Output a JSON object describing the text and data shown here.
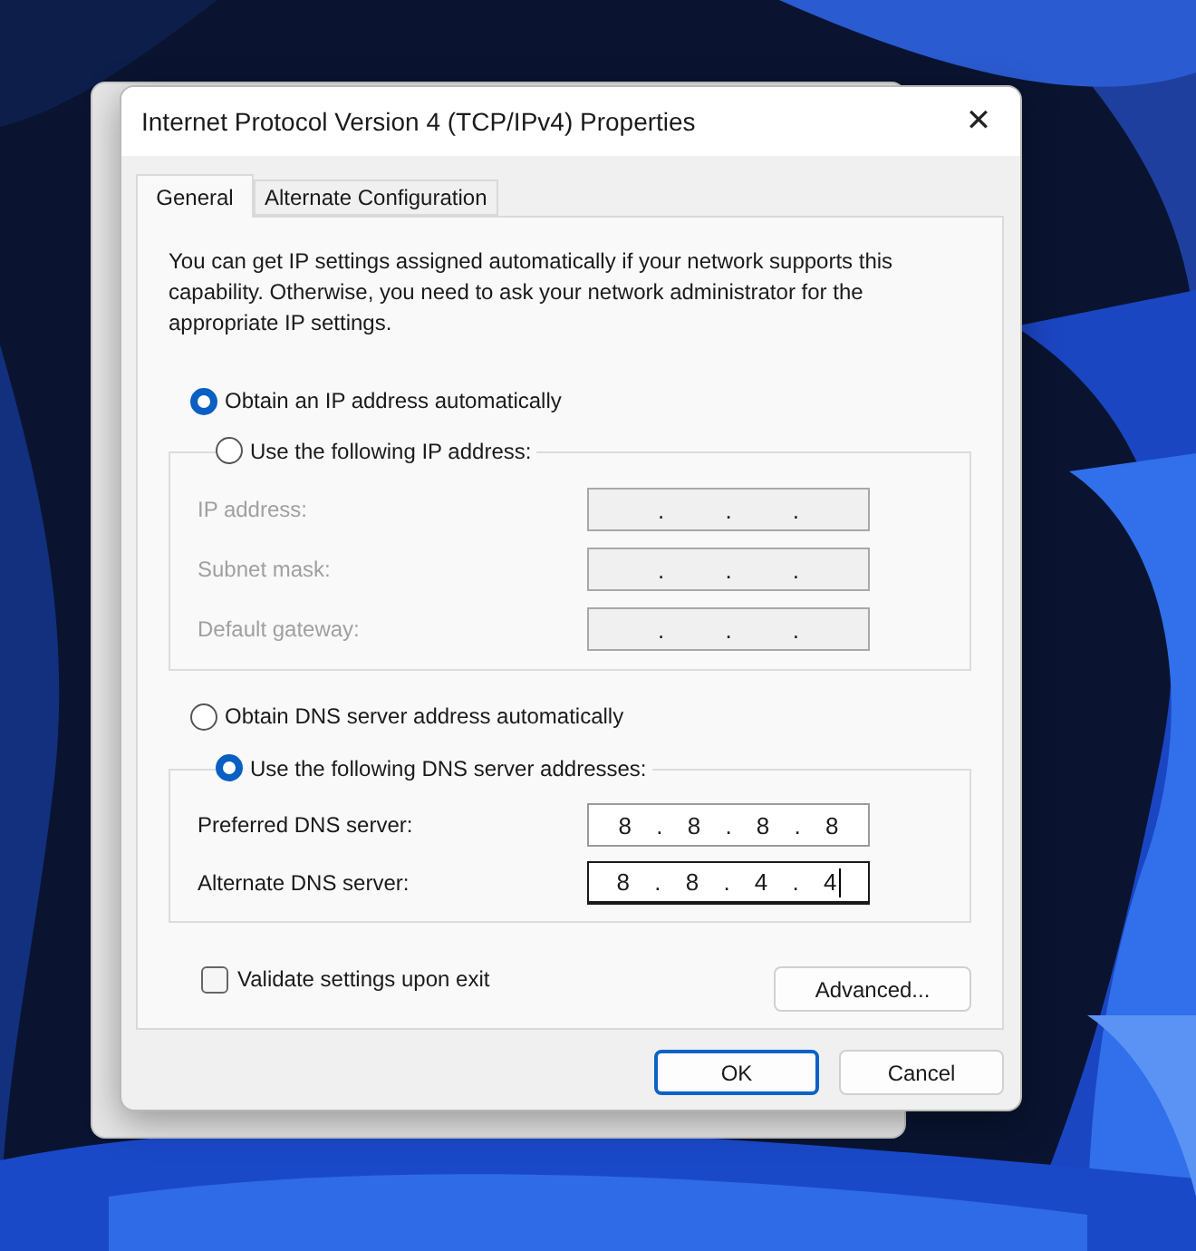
{
  "window": {
    "title": "Internet Protocol Version 4 (TCP/IPv4) Properties",
    "close": "✕"
  },
  "tabs": [
    {
      "label": "General",
      "selected": true
    },
    {
      "label": "Alternate Configuration",
      "selected": false
    }
  ],
  "description": "You can get IP settings assigned automatically if your network supports this capability. Otherwise, you need to ask your network administrator for the appropriate IP settings.",
  "ip_mode": [
    {
      "label": "Obtain an IP address automatically",
      "selected": true
    },
    {
      "label": "Use the following IP address:",
      "selected": false
    }
  ],
  "ip_fields": [
    {
      "label": "IP address:",
      "value": ". . .",
      "disabled": true
    },
    {
      "label": "Subnet mask:",
      "value": ". . .",
      "disabled": true
    },
    {
      "label": "Default gateway:",
      "value": ". . .",
      "disabled": true
    }
  ],
  "dns_mode": [
    {
      "label": "Obtain DNS server address automatically",
      "selected": false
    },
    {
      "label": "Use the following DNS server addresses:",
      "selected": true
    }
  ],
  "dns_fields": [
    {
      "label": "Preferred DNS server:",
      "value": "8 . 8 . 8 . 8",
      "disabled": false,
      "focused": false
    },
    {
      "label": "Alternate DNS server:",
      "value": "8 . 8 . 4 . 4",
      "disabled": false,
      "focused": true
    }
  ],
  "validate": {
    "label": "Validate settings upon exit",
    "checked": false
  },
  "advanced_button": "Advanced...",
  "buttons": [
    {
      "label": "OK",
      "default": true
    },
    {
      "label": "Cancel",
      "default": false
    }
  ]
}
